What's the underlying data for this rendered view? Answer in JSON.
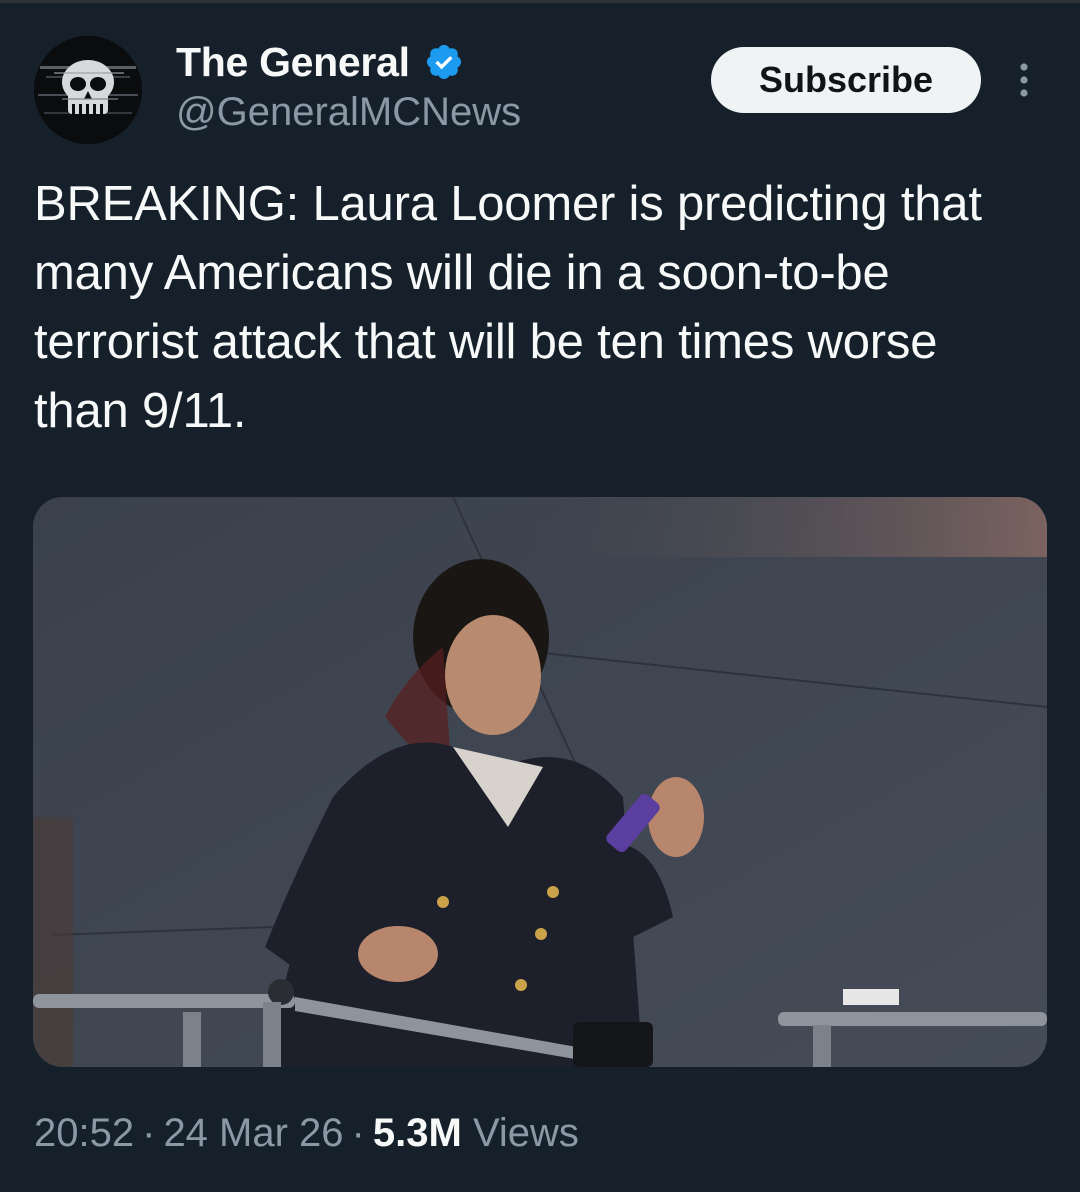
{
  "author": {
    "display_name": "The General",
    "handle": "@GeneralMCNews",
    "verified": true,
    "verified_color": "#1d9bf0",
    "avatar_icon": "skull-logo"
  },
  "actions": {
    "subscribe_label": "Subscribe",
    "more_icon": "more-vertical-icon"
  },
  "tweet": {
    "text": "BREAKING: Laura Loomer is predicting that many Americans will die in a soon-to-be terrorist attack that will be ten times worse than 9/11."
  },
  "media": {
    "type": "photo"
  },
  "meta": {
    "time": "20:52",
    "separator": "·",
    "date": "24 Mar 26",
    "views_count": "5.3M",
    "views_label": "Views"
  },
  "colors": {
    "background": "#15202b",
    "text_primary": "#f7f9f9",
    "text_secondary": "#8b98a5",
    "button_bg": "#eff3f4"
  }
}
